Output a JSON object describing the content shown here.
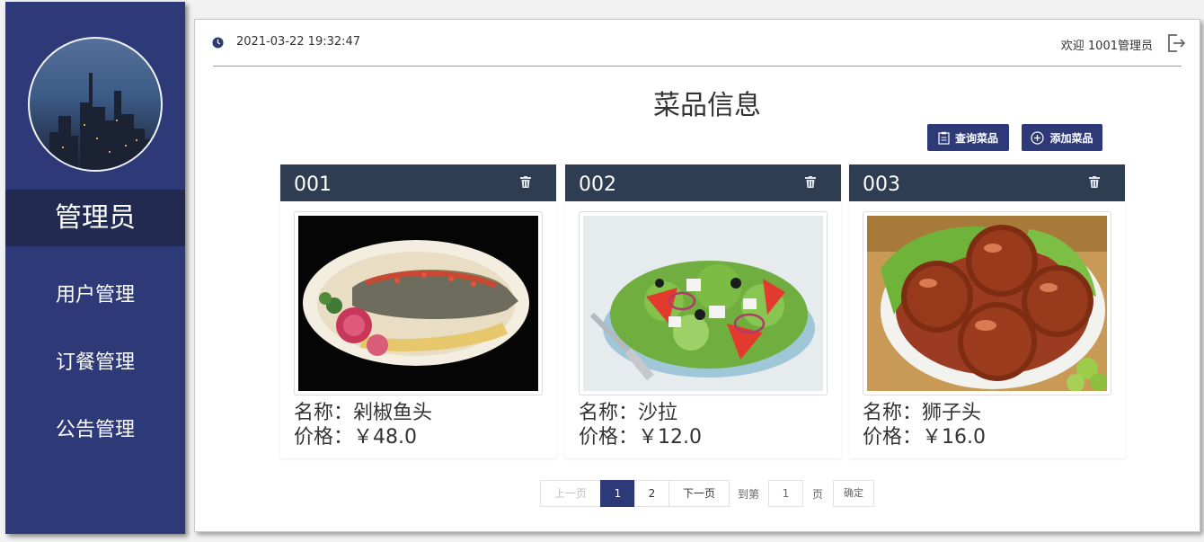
{
  "header": {
    "datetime": "2021-03-22 19:32:47",
    "welcome": "欢迎 1001管理员"
  },
  "sidebar": {
    "role": "管理员",
    "items": [
      {
        "label": "用户管理"
      },
      {
        "label": "订餐管理"
      },
      {
        "label": "公告管理"
      }
    ]
  },
  "page": {
    "title": "菜品信息",
    "search_label": "查询菜品",
    "add_label": "添加菜品"
  },
  "dishes": [
    {
      "id": "001",
      "name": "名称：剁椒鱼头",
      "price": "价格：￥48.0"
    },
    {
      "id": "002",
      "name": "名称：沙拉",
      "price": "价格：￥12.0"
    },
    {
      "id": "003",
      "name": "名称：狮子头",
      "price": "价格：￥16.0"
    }
  ],
  "pagination": {
    "prev": "上一页",
    "page1": "1",
    "page2": "2",
    "next": "下一页",
    "goto": "到第",
    "goto_value": "1",
    "page_unit": "页",
    "confirm": "确定",
    "current_page": 1
  },
  "colors": {
    "sidebar": "#2e3a78",
    "role_bg": "#232a52",
    "card_head": "#2f3d53",
    "accent": "#2e3a78"
  }
}
